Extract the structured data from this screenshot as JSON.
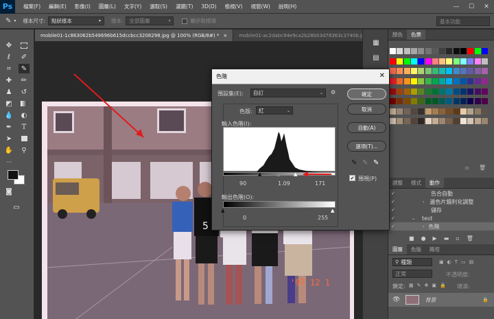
{
  "menubar": {
    "logo": "Ps",
    "items": [
      "檔案(F)",
      "編輯(E)",
      "影像(I)",
      "圖層(L)",
      "文字(Y)",
      "選取(S)",
      "濾鏡(T)",
      "3D(D)",
      "檢視(V)",
      "視窗(W)",
      "說明(H)"
    ],
    "minimize": "—",
    "maximize": "☐",
    "close": "✕"
  },
  "options": {
    "sample_size_label": "樣本尺寸:",
    "sample_size_value": "點狀樣本",
    "sample_label": "樣本:",
    "sample_value": "全部圖層",
    "show_ring_label": "顯示取樣環",
    "workspace": "基本功能"
  },
  "tabs": [
    {
      "label": "mobile01-1c863062b549696b615dccbcc3208298.jpg @ 100% (RGB/8#) *",
      "close": "×"
    },
    {
      "label": "mobile01-ac2dabc94e9ca2b28b03d78363c3740b.jpg",
      "close": "×"
    }
  ],
  "dialog": {
    "title": "色階",
    "close": "✕",
    "preset_label": "預設集(E):",
    "preset_value": "自訂",
    "channel_label": "色版:",
    "channel_value": "紅",
    "input_levels_label": "輸入色階(I):",
    "input_black": "90",
    "input_gamma": "1.09",
    "input_white": "171",
    "output_levels_label": "輸出色階(O):",
    "output_black": "0",
    "output_white": "255",
    "ok": "確定",
    "cancel": "取消",
    "auto": "自動(A)",
    "options": "選項(T)...",
    "preview": "預視(P)",
    "preview_checked": "✔"
  },
  "photo": {
    "date_stamp": "'97 12 1",
    "jersey_number": "5"
  },
  "panels": {
    "top_tabs": [
      "顏色",
      "色票"
    ],
    "mid_tabs": [
      "調整",
      "樣式",
      "動作"
    ],
    "actions": [
      {
        "label": "告合自動"
      },
      {
        "label": "邊色片鏡利化調整"
      },
      {
        "label": "儲存"
      },
      {
        "label": "test"
      },
      {
        "label": "色階"
      }
    ],
    "layers_tabs": [
      "圖層",
      "色版",
      "路徑"
    ],
    "kind_label": "種類",
    "blend_mode": "正常",
    "opacity_label": "不透明度:",
    "lock_label": "鎖定:",
    "fill_label": "填滿:",
    "layer_name": "背景"
  },
  "colors": {
    "accent_red": "#e21b1b",
    "panel_bg": "#535353"
  }
}
